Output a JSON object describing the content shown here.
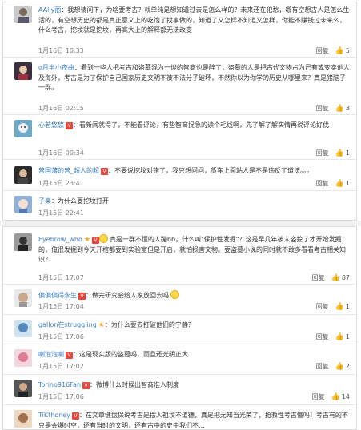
{
  "panel1": [
    {
      "user": "AAlly丽",
      "badge": "",
      "text": "：我想请问下，为啥要考古？就单纯是想知道过去是怎么样的？未来还在犯愁，哪有空想古人是怎么生活的，有空想历史的都是真正意义上的吃饱了找事做的，知道了又怎样不知道又怎样，你能不赚钱过未来么，什么考古，挖坟就是挖坟，再高大上的解释都无法改变",
      "time": "1月16日 10:33",
      "reply": "回复",
      "likes": "5"
    },
    {
      "user": "o月半小夜曲",
      "badge": "",
      "text": "：看到一些人把考古和盗墓混为一谈的智商也是醉了，盗墓的人是把古代文物占为己有或变卖他人及海外，考古是为了保护自己国家历史文明不被不法分子破坏，不然你以为你学的历史从哪里来？真是猪脑子一群。",
      "time": "1月16日 02:15",
      "reply": "回复",
      "likes": "3"
    },
    {
      "user": "心若悠悠",
      "badge": "V",
      "text": "：看新闻就得了，不能看评论，有些智商捉急的读个毛线啊，先了解了解实情再说评论好伐",
      "time": "1月16日 00:34",
      "reply": "回复",
      "likes": "1"
    },
    {
      "user": "曾国藩的曾_超人的超",
      "badge": "V",
      "text": "：不要说挖坟对错了，我只想问问，货车上面站人是不是违反了道法。。。",
      "time": "1月15日 23:41",
      "reply": "回复",
      "likes": "1"
    },
    {
      "user": "子楽",
      "badge": "",
      "text": "：为什么要挖坟打开",
      "time": "1月15日 22:41",
      "reply": "",
      "likes": ""
    }
  ],
  "panel2": [
    {
      "user": "Eyebrow_who",
      "star": "★",
      "badge": "V",
      "text": "真是一群不懂的人蹦bb，什么叫\"保护性发掘\"？这是早几年被人盗挖了才开始发掘的，俺很发掘到今天开棺都要到实验室但是开启，就怕损害文物。要盗墓小说的同时就不敢多看看考古相关知识？",
      "time": "1月15日 17:07",
      "reply": "回复",
      "likes": "87"
    },
    {
      "user": "偏偏偏得永生",
      "badge": "V",
      "text": "：做完研究会给人家放回去吗",
      "time": "1月15日 17:04",
      "reply": "回复",
      "likes": "1"
    },
    {
      "user": "gallon在struggling",
      "star": "★",
      "badge": "",
      "text": "：为什么要去打破他们的宁静？",
      "time": "1月15日 17:06",
      "reply": "回复",
      "likes": "1"
    },
    {
      "user": "喇泡泡喇",
      "badge": "V",
      "text": "：这是现实版的盗墓吗，而且还光明正大",
      "time": "1月15日 17:02",
      "reply": "回复",
      "likes": "2"
    },
    {
      "user": "Torino916Fan",
      "badge": "V",
      "text": "：微博什么时候出智商准入制度",
      "time": "1月15日 17:06",
      "reply": "回复",
      "likes": "14"
    },
    {
      "user": "TiKthoney",
      "badge": "V",
      "text": "：在文章健盘保说考古是摆人祖坟不道德，真是把无知当光荣了，抢救性考古懂吗！考古有的不只是会爆时空，还有当时的文明，还有古中的史中我们不...",
      "time": "",
      "reply": "",
      "likes": ""
    }
  ],
  "colors": {
    "username": "#eb7350",
    "badge": "#e8463c",
    "time": "#808080",
    "star": "#f5a623"
  },
  "icons": {
    "like": "thumbs-up-icon",
    "badge": "vip-badge-icon",
    "star": "star-icon",
    "emoji": "smile-emoji-icon"
  }
}
